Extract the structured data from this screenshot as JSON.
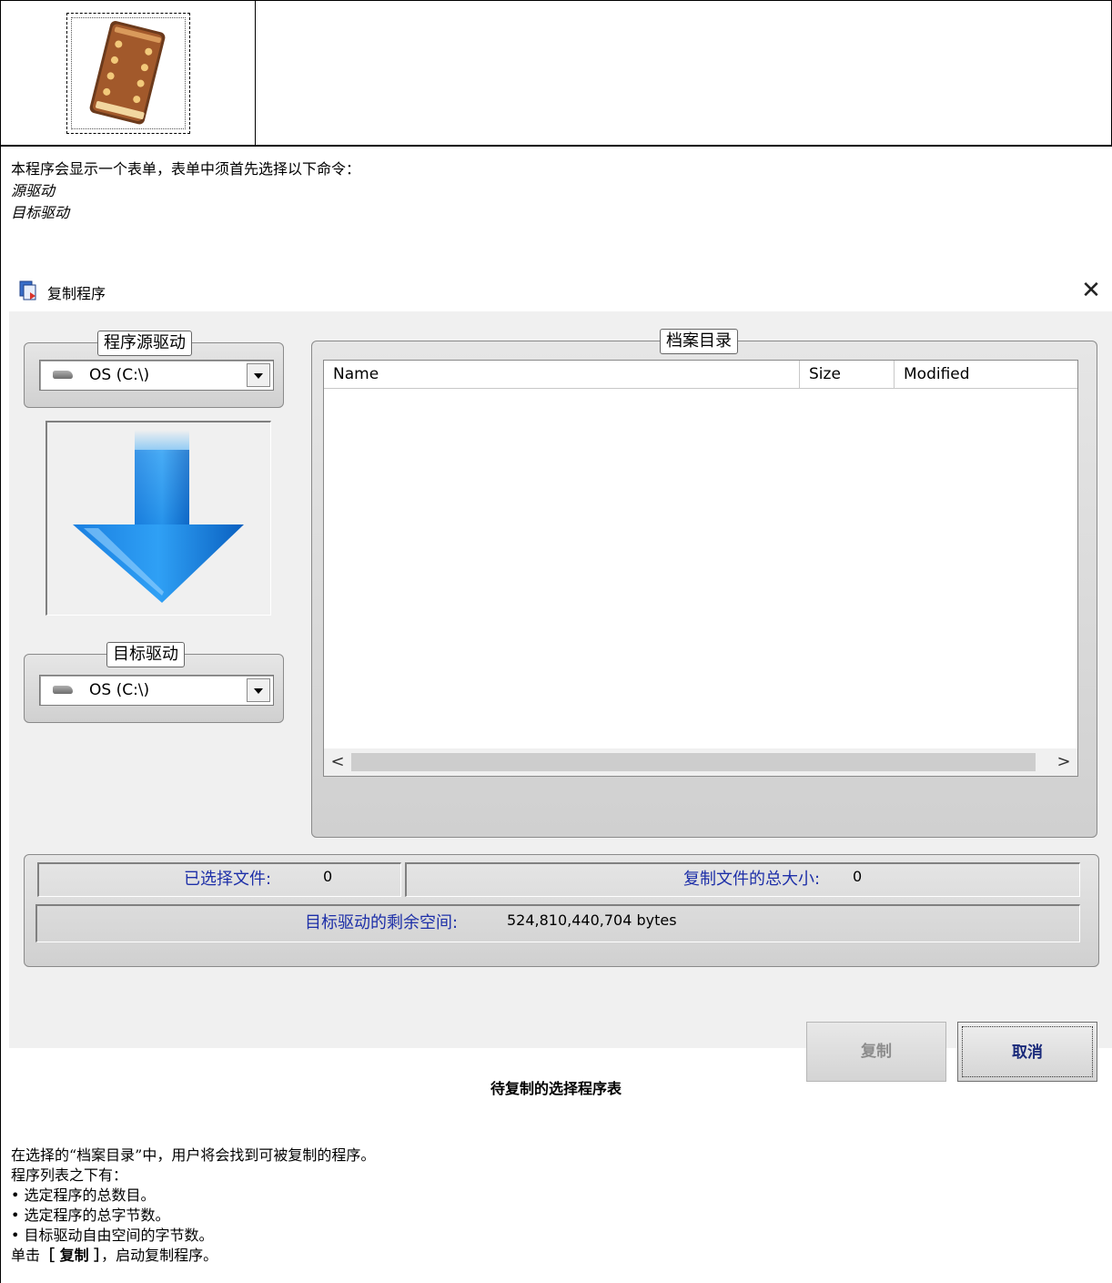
{
  "intro": {
    "line1": "本程序会显示一个表单，表单中须首先选择以下命令：",
    "item1": "源驱动",
    "item2": "目标驱动"
  },
  "dialog": {
    "title": "复制程序",
    "close_glyph": "✕",
    "source_group_label": "程序源驱动",
    "source_drive_value": "OS (C:\\)",
    "target_group_label": "目标驱动",
    "target_drive_value": "OS (C:\\)",
    "archive_group_label": "档案目录",
    "columns": [
      "Name",
      "Size",
      "Modified"
    ],
    "scroll_left": "<",
    "scroll_right": ">",
    "selected_files_label": "已选择文件:",
    "selected_files_value": "0",
    "total_size_label": "复制文件的总大小:",
    "total_size_value": "0",
    "free_space_label": "目标驱动的剩余空间:",
    "free_space_value": "524,810,440,704 bytes",
    "copy_button": "复制",
    "cancel_button": "取消",
    "copy_enabled": false
  },
  "caption": "待复制的选择程序表",
  "body": {
    "line1": "在选择的“档案目录”中，用户将会找到可被复制的程序。",
    "line2": "程序列表之下有：",
    "bullets": [
      "选定程序的总数目。",
      "选定程序的总字节数。",
      "目标驱动自由空间的字节数。"
    ],
    "last_prefix": "单击",
    "last_bold": "［ 复制 ］",
    "last_suffix": "，启动复制程序。"
  },
  "colors": {
    "status_label": "#1d2fa8",
    "dialog_background": "#f0f0f0",
    "arrow_blue": "#1e8fe0"
  },
  "icons": [
    "book-icon",
    "app-copy-icon",
    "close-icon",
    "drive-icon",
    "dropdown-arrow-icon",
    "down-arrow-graphic"
  ]
}
